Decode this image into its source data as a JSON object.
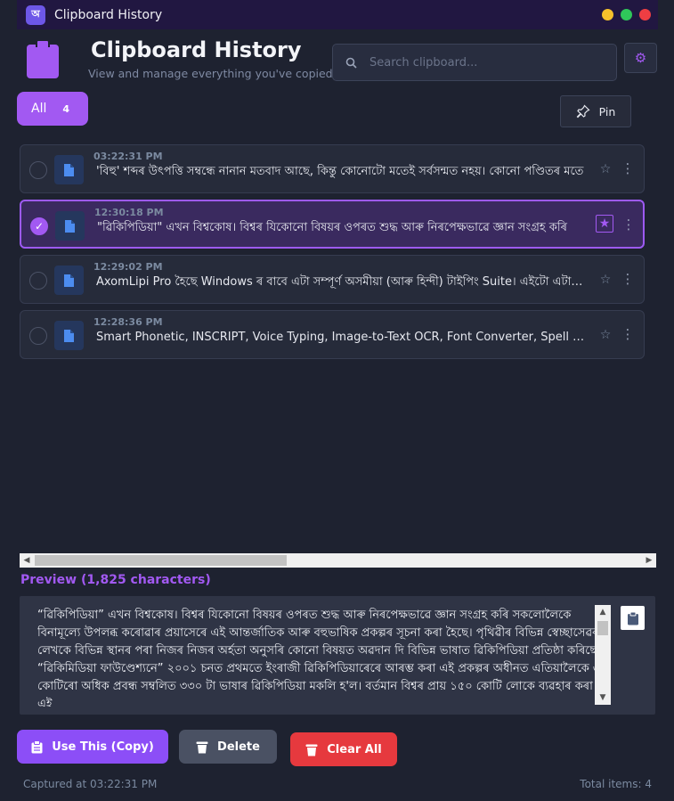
{
  "window": {
    "title": "Clipboard History",
    "logo_glyph": "অ",
    "traffic_colors": [
      "#f6c12b",
      "#2fc75a",
      "#ee3e43"
    ]
  },
  "header": {
    "title": "Clipboard History",
    "subtitle": "View and manage everything you've copied"
  },
  "search": {
    "placeholder": "Search clipboard..."
  },
  "filters": {
    "all_label": "All",
    "all_count": "4",
    "pin_label": "Pin"
  },
  "items": [
    {
      "time": "03:22:31 PM",
      "text": "'বিহু' শব্দৰ উৎপত্তি সম্বন্ধে নানান মতবাদ আছে, কিন্তু কোনোটো মতেই সৰ্বসন্মত নহয়। কোনো পণ্ডিতৰ মতে",
      "selected": false,
      "starred": false
    },
    {
      "time": "12:30:18 PM",
      "text": "\"ৱিকিপিডিয়া\" এখন বিশ্বকোষ। বিশ্বৰ যিকোনো বিষয়ৰ ওপৰত শুদ্ধ আৰু নিৰপেক্ষভাৱে জ্ঞান সংগ্ৰহ কৰি",
      "selected": true,
      "starred": true
    },
    {
      "time": "12:29:02 PM",
      "text": "AxomLipi Pro হৈছে Windows ৰ বাবে এটা সম্পূৰ্ণ অসমীয়া (আৰু হিন্দী) টাইপিং Suite। এইটো এটা শক্তিশালী",
      "selected": false,
      "starred": false
    },
    {
      "time": "12:28:36 PM",
      "text": "Smart Phonetic, INSCRIPT, Voice Typing, Image-to-Text OCR, Font Converter, Spell Checker আৰু বহুতো",
      "selected": false,
      "starred": false
    }
  ],
  "preview": {
    "label": "Preview",
    "count": "(1,825 characters)",
    "text": "“ৱিকিপিডিয়া” এখন বিশ্বকোষ। বিশ্বৰ যিকোনো বিষয়ৰ ওপৰত শুদ্ধ আৰু নিৰপেক্ষভাৱে জ্ঞান সংগ্ৰহ কৰি সকলোলৈকে বিনামূল্যে উপলব্ধ কৰোৱাৰ প্ৰয়াসেৰে এই আন্তৰ্জাতিক আৰু বহুভাষিক প্ৰকল্পৰ সূচনা কৰা হৈছে। পৃথিৱীৰ বিভিন্ন স্বেচ্ছাসেৱক লেখকে বিভিন্ন স্থানৰ পৰা নিজৰ নিজৰ অৰ্হতা অনুসৰি কোনো বিষয়ত অৱদান দি বিভিন্ন ভাষাত ৱিকিপিডিয়া প্ৰতিষ্ঠা কৰিছে। “ৱিকিমিডিয়া ফাউণ্ডেশ্যনে” ২০০১ চনত প্ৰথমতে ইংৰাজী ৱিকিপিডিয়াৰেৰে আৰম্ভ কৰা এই প্ৰকল্পৰ অধীনত এতিয়ালৈকে ৬ কোটিৰো অধিক প্ৰবন্ধ সম্বলিত ৩৩০ টা ভাষাৰ ৱিকিপিডিয়া মকলি হ'ল। বৰ্তমান বিশ্বৰ প্ৰায় ১৫০ কোটি লোকে ব্যৱহাৰ কৰা এই"
  },
  "actions": {
    "use_label": "Use This (Copy)",
    "delete_label": "Delete",
    "clear_label": "Clear All"
  },
  "footer": {
    "captured": "Captured at 03:22:31 PM",
    "total": "Total items: 4"
  },
  "colors": {
    "accent": "#a259f2",
    "background": "#1e2230",
    "danger": "#e6393e"
  }
}
